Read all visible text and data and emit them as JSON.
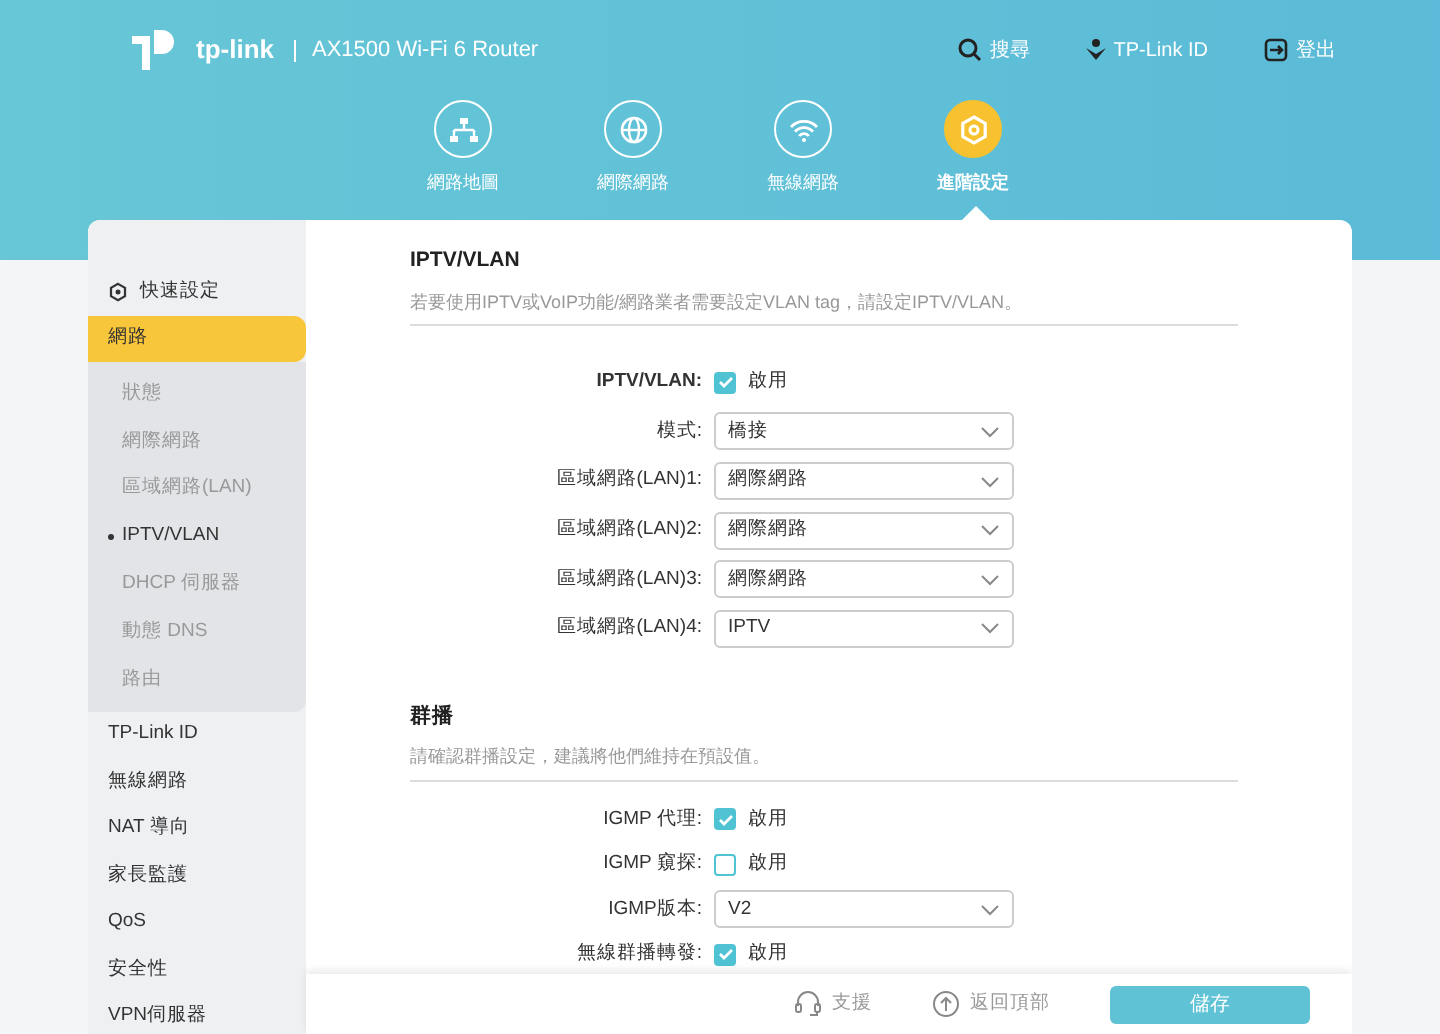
{
  "header": {
    "brand": "tp-link",
    "model": "AX1500 Wi-Fi 6 Router",
    "actions": [
      {
        "kind": "search",
        "label": "搜尋"
      },
      {
        "kind": "id",
        "label": "TP-Link ID"
      },
      {
        "kind": "logout",
        "label": "登出"
      }
    ],
    "nav": [
      {
        "kind": "map",
        "label": "網路地圖",
        "selected": false
      },
      {
        "kind": "internet",
        "label": "網際網路",
        "selected": false
      },
      {
        "kind": "wireless",
        "label": "無線網路",
        "selected": false
      },
      {
        "kind": "advanced",
        "label": "進階設定",
        "selected": true
      }
    ]
  },
  "sidebar": {
    "items": [
      {
        "label": "快速設定",
        "kind": "quick",
        "selected": false
      },
      {
        "label": "網路",
        "kind": "group",
        "selected": true,
        "expanded": true,
        "children": [
          {
            "label": "狀態",
            "selected": false
          },
          {
            "label": "網際網路",
            "selected": false
          },
          {
            "label": "區域網路(LAN)",
            "selected": false
          },
          {
            "label": "IPTV/VLAN",
            "selected": true
          },
          {
            "label": "DHCP 伺服器",
            "selected": false
          },
          {
            "label": "動態 DNS",
            "selected": false
          },
          {
            "label": "路由",
            "selected": false
          }
        ]
      },
      {
        "label": "TP-Link ID",
        "kind": "group",
        "selected": false
      },
      {
        "label": "無線網路",
        "kind": "group",
        "selected": false
      },
      {
        "label": "NAT 導向",
        "kind": "group",
        "selected": false
      },
      {
        "label": "家長監護",
        "kind": "group",
        "selected": false
      },
      {
        "label": "QoS",
        "kind": "group",
        "selected": false
      },
      {
        "label": "安全性",
        "kind": "group",
        "selected": false
      },
      {
        "label": "VPN伺服器",
        "kind": "group",
        "selected": false
      }
    ]
  },
  "sections": [
    {
      "title": "IPTV/VLAN",
      "description": "若要使用IPTV或VoIP功能/網路業者需要設定VLAN tag，請設定IPTV/VLAN。",
      "fields": [
        {
          "kind": "checkbox",
          "label": "IPTV/VLAN:",
          "option": "啟用",
          "checked": true
        },
        {
          "kind": "select",
          "label": "模式:",
          "value": "橋接"
        },
        {
          "kind": "select",
          "label": "區域網路(LAN)1:",
          "value": "網際網路"
        },
        {
          "kind": "select",
          "label": "區域網路(LAN)2:",
          "value": "網際網路"
        },
        {
          "kind": "select",
          "label": "區域網路(LAN)3:",
          "value": "網際網路"
        },
        {
          "kind": "select",
          "label": "區域網路(LAN)4:",
          "value": "IPTV"
        }
      ]
    },
    {
      "title": "群播",
      "description": "請確認群播設定，建議將他們維持在預設值。",
      "fields": [
        {
          "kind": "checkbox",
          "label": "IGMP 代理:",
          "option": "啟用",
          "checked": true
        },
        {
          "kind": "checkbox",
          "label": "IGMP 窺探:",
          "option": "啟用",
          "checked": false
        },
        {
          "kind": "select",
          "label": "IGMP版本:",
          "value": "V2"
        },
        {
          "kind": "checkbox",
          "label": "無線群播轉發:",
          "option": "啟用",
          "checked": true
        }
      ]
    }
  ],
  "footer": {
    "support": "支援",
    "back_to_top": "返回頂部",
    "save": "儲存"
  }
}
